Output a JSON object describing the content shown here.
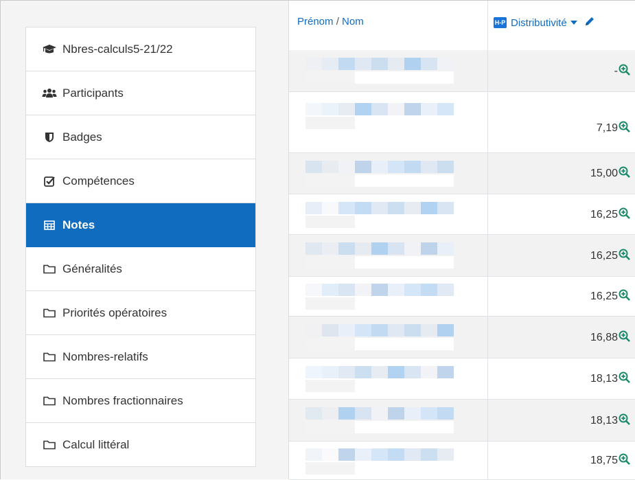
{
  "sidebar": {
    "items": [
      {
        "label": "Nbres-calculs5-21/22",
        "icon": "graduation-cap-icon",
        "active": false
      },
      {
        "label": "Participants",
        "icon": "users-icon",
        "active": false
      },
      {
        "label": "Badges",
        "icon": "shield-icon",
        "active": false
      },
      {
        "label": "Compétences",
        "icon": "check-square-icon",
        "active": false
      },
      {
        "label": "Notes",
        "icon": "table-icon",
        "active": true
      },
      {
        "label": "Généralités",
        "icon": "folder-icon",
        "active": false
      },
      {
        "label": "Priorités opératoires",
        "icon": "folder-icon",
        "active": false
      },
      {
        "label": "Nombres-relatifs",
        "icon": "folder-icon",
        "active": false
      },
      {
        "label": "Nombres fractionnaires",
        "icon": "folder-icon",
        "active": false
      },
      {
        "label": "Calcul littéral",
        "icon": "folder-icon",
        "active": false
      }
    ]
  },
  "grades": {
    "header": {
      "first_name": "Prénom",
      "separator": "/",
      "last_name": "Nom",
      "badge": "H-P",
      "item": "Distributivité"
    },
    "rows": [
      {
        "grade": "-"
      },
      {
        "grade": "7,19"
      },
      {
        "grade": "15,00"
      },
      {
        "grade": "16,25"
      },
      {
        "grade": "16,25"
      },
      {
        "grade": "16,25"
      },
      {
        "grade": "16,88"
      },
      {
        "grade": "18,13"
      },
      {
        "grade": "18,13"
      },
      {
        "grade": "18,75"
      }
    ]
  },
  "colors": {
    "accent": "#0f6cbf",
    "zoom_icon": "#1a8a6a"
  }
}
